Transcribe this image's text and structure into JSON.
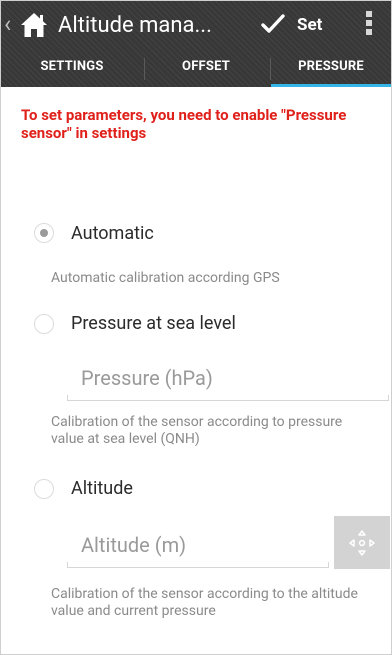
{
  "action_bar": {
    "title": "Altitude mana...",
    "set_label": "Set",
    "icons": [
      "up-caret-icon",
      "home-icon",
      "check-icon",
      "overflow-menu-icon"
    ]
  },
  "tabs": [
    {
      "label": "SETTINGS",
      "selected": false
    },
    {
      "label": "OFFSET",
      "selected": false
    },
    {
      "label": "PRESSURE",
      "selected": true
    }
  ],
  "content": {
    "warning": "To set parameters, you need to enable \"Pressure sensor\" in settings",
    "options": [
      {
        "label": "Automatic",
        "selected": true
      },
      {
        "label": "Pressure at sea level",
        "selected": false
      },
      {
        "label": "Altitude",
        "selected": false
      }
    ],
    "automatic_hint": "Automatic calibration according GPS",
    "pressure_placeholder": "Pressure (hPa)",
    "pressure_hint": "Calibration of the sensor according to pressure value at sea level (QNH)",
    "altitude_placeholder": "Altitude (m)",
    "altitude_hint": "Calibration of the sensor according to the altitude value and current pressure",
    "gps_icon": "gps-locate-icon"
  },
  "colors": {
    "action_bar": "#383838",
    "tab_indicator": "#33b5e5",
    "warning": "#e0201a"
  }
}
